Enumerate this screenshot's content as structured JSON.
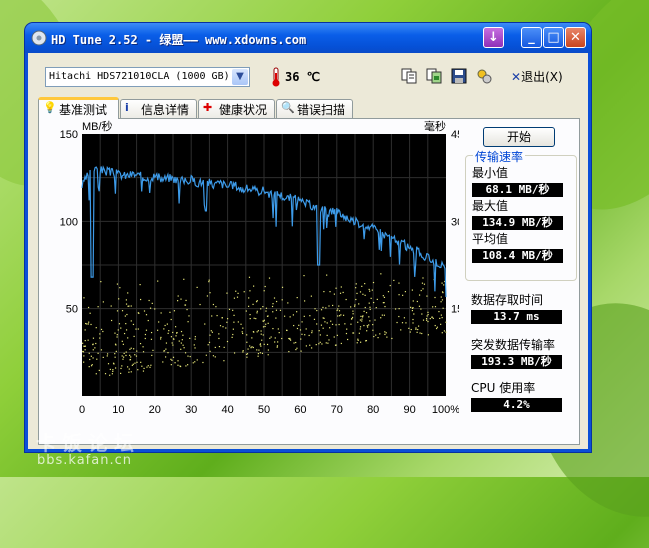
{
  "window": {
    "title": "HD Tune 2.52 - 绿盟—— www.xdowns.com",
    "controls": {
      "download": "↓",
      "minimize": "_",
      "maximize": "□",
      "close": "✕"
    }
  },
  "toolbar": {
    "drive": "Hitachi HDS721010CLA (1000 GB)",
    "temperature": "36 ℃",
    "exit_label": "退出(X)",
    "exit_prefix": "✕",
    "tools": [
      "copy-text-icon",
      "copy-image-icon",
      "save-icon",
      "options-icon"
    ]
  },
  "tabs": [
    {
      "label": "基准测试",
      "icon": "benchmark-icon",
      "active": true
    },
    {
      "label": "信息详情",
      "icon": "info-icon",
      "active": false
    },
    {
      "label": "健康状况",
      "icon": "health-icon",
      "active": false
    },
    {
      "label": "错误扫描",
      "icon": "error-scan-icon",
      "active": false
    }
  ],
  "benchmark": {
    "start_label": "开始",
    "transfer_group_title": "传输速率",
    "min_label": "最小值",
    "min_value": "68.1 MB/秒",
    "max_label": "最大值",
    "max_value": "134.9 MB/秒",
    "avg_label": "平均值",
    "avg_value": "108.4 MB/秒",
    "access_label": "数据存取时间",
    "access_value": "13.7 ms",
    "burst_label": "突发数据传输率",
    "burst_value": "193.3 MB/秒",
    "cpu_label": "CPU 使用率",
    "cpu_value": "4.2%"
  },
  "chart_data": {
    "type": "line",
    "ylabel_left": "MB/秒",
    "ylabel_right": "毫秒",
    "left_ylim": [
      0,
      150
    ],
    "right_ylim": [
      0,
      45
    ],
    "left_ticks": [
      "150",
      "100",
      "50"
    ],
    "right_ticks": [
      "45",
      "30",
      "15"
    ],
    "x_ticks": [
      "0",
      "10",
      "20",
      "30",
      "40",
      "50",
      "60",
      "70",
      "80",
      "90",
      "100%"
    ],
    "grid": true,
    "series": [
      {
        "kind": "transfer_rate_line",
        "color": "#3d9be9",
        "x": [
          0,
          2,
          4,
          6,
          8,
          10,
          12,
          14,
          16,
          18,
          20,
          22,
          24,
          26,
          28,
          30,
          32,
          34,
          36,
          38,
          40,
          42,
          44,
          46,
          48,
          50,
          52,
          54,
          56,
          58,
          60,
          62,
          64,
          66,
          68,
          70,
          72,
          74,
          76,
          78,
          80,
          82,
          84,
          86,
          88,
          90,
          92,
          94,
          96,
          98,
          100
        ],
        "y": [
          120,
          128,
          130,
          129,
          128,
          127,
          126,
          127,
          126,
          125,
          126,
          124,
          125,
          124,
          123,
          124,
          122,
          123,
          121,
          122,
          120,
          121,
          118,
          119,
          117,
          118,
          115,
          116,
          113,
          114,
          111,
          110,
          108,
          107,
          105,
          106,
          103,
          101,
          99,
          98,
          96,
          93,
          92,
          89,
          88,
          84,
          83,
          80,
          78,
          76,
          73
        ]
      },
      {
        "kind": "access_time_points",
        "color": "#e8e87a",
        "x_range": [
          0,
          100
        ],
        "y_range_ms": [
          3,
          23
        ]
      }
    ]
  }
}
